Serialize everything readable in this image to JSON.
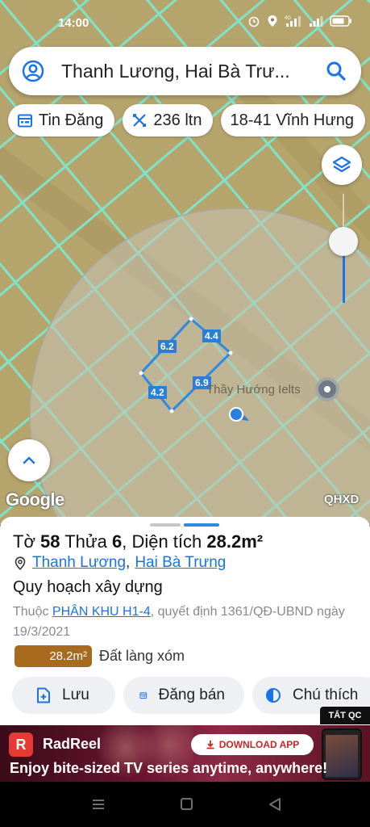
{
  "status_bar": {
    "time": "14:00",
    "network": "4G"
  },
  "search": {
    "query": "Thanh Lương, Hai Bà Trư..."
  },
  "chips": [
    {
      "label": "Tin Đăng",
      "icon": "calendar-icon"
    },
    {
      "label": "236 ltn",
      "icon": "ruler-icon"
    },
    {
      "label": "18-41 Vĩnh Hưng",
      "icon": ""
    }
  ],
  "map": {
    "parcel_edges": [
      "6.2",
      "4.4",
      "4.2",
      "6.9"
    ],
    "poi_name": "Thầy Hướng Ielts",
    "google_logo": "Google",
    "provider_logo": "QHXD",
    "colors": {
      "ground": "#b8a56e",
      "grid_lines": "#7fe3c8",
      "parcel": "#2a8ce0",
      "circle": "#c4c0b2"
    }
  },
  "sheet": {
    "title_prefix": "Tờ",
    "to": "58",
    "thua_label": "Thửa",
    "thua": "6",
    "area_label": ", Diện tích",
    "area": "28.2m²",
    "address_ward": "Thanh Lương",
    "address_separator": ",",
    "address_district": "Hai Bà Trưng",
    "section_title": "Quy hoạch xây dựng",
    "desc_prefix": "Thuộc",
    "desc_link": "PHÂN KHU H1-4",
    "desc_suffix": ", quyết định 1361/QĐ-UBND ngày 19/3/2021",
    "legend": {
      "value": "28.2m²",
      "name": "Đất làng xóm",
      "color": "#a76a1f"
    },
    "actions": [
      {
        "label": "Lưu",
        "icon": "add-note-icon"
      },
      {
        "label": "Đăng bán",
        "icon": "calendar-icon"
      },
      {
        "label": "Chú thích",
        "icon": "contrast-icon"
      }
    ]
  },
  "ad": {
    "close_label": "TẮT QC",
    "logo_letter": "R",
    "brand": "RadReel",
    "cta": "DOWNLOAD APP",
    "tagline": "Enjoy bite-sized TV series anytime, anywhere!"
  }
}
